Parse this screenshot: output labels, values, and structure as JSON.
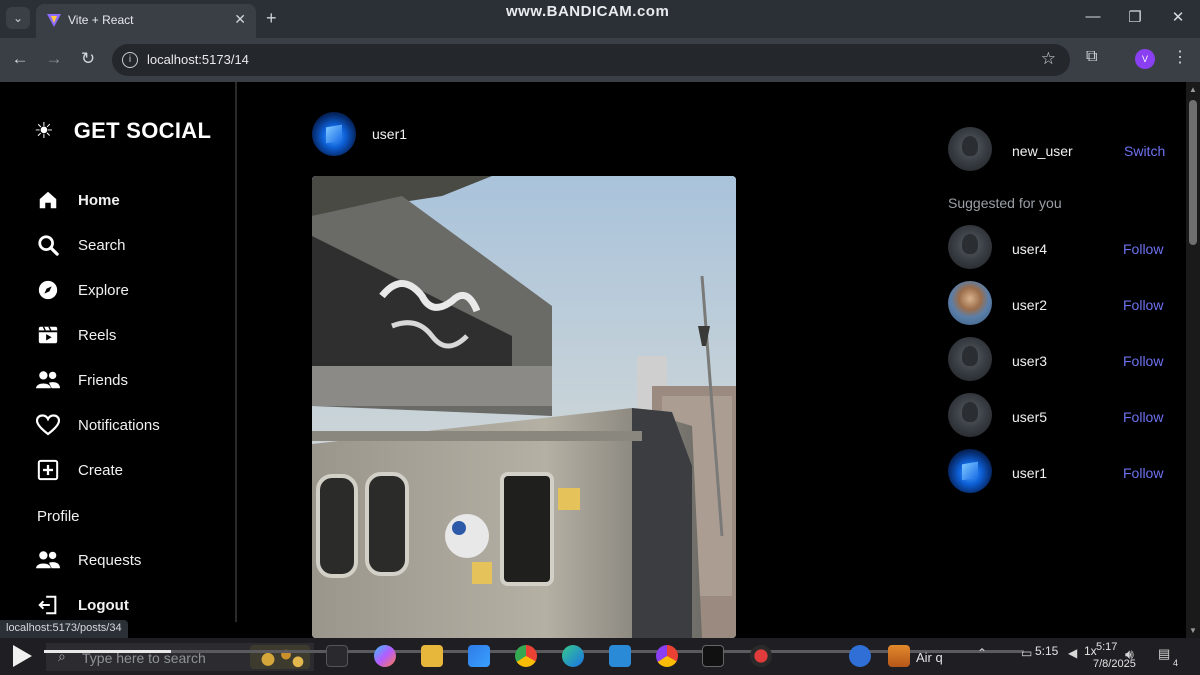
{
  "browser": {
    "tab_title": "Vite + React",
    "url": "localhost:5173/14",
    "status_url": "localhost:5173/posts/34",
    "watermark": "www.BANDICAM.com",
    "profile_initial": "V"
  },
  "app": {
    "brand": "GET SOCIAL",
    "nav": [
      {
        "label": "Home",
        "icon": "home-icon",
        "active": true
      },
      {
        "label": "Search",
        "icon": "search-icon"
      },
      {
        "label": "Explore",
        "icon": "compass-icon"
      },
      {
        "label": "Reels",
        "icon": "film-icon"
      },
      {
        "label": "Friends",
        "icon": "users-icon"
      },
      {
        "label": "Notifications",
        "icon": "heart-icon"
      },
      {
        "label": "Create",
        "icon": "plus-square-icon"
      }
    ],
    "profile_heading": "Profile",
    "nav_bottom": [
      {
        "label": "Requests",
        "icon": "users-icon"
      },
      {
        "label": "Logout",
        "icon": "logout-icon",
        "active": true
      }
    ]
  },
  "post": {
    "username": "user1"
  },
  "current_user": {
    "username": "new_user",
    "action": "Switch"
  },
  "suggestions": {
    "heading": "Suggested for you",
    "users": [
      {
        "username": "user4",
        "action": "Follow",
        "avatar": "gray"
      },
      {
        "username": "user2",
        "action": "Follow",
        "avatar": "photo"
      },
      {
        "username": "user3",
        "action": "Follow",
        "avatar": "gray"
      },
      {
        "username": "user5",
        "action": "Follow",
        "avatar": "gray"
      },
      {
        "username": "user1",
        "action": "Follow",
        "avatar": "blue"
      }
    ]
  },
  "taskbar": {
    "search_placeholder": "Type here to search",
    "weather_text": "Air q",
    "time_player": "5:15",
    "speed": "1x",
    "clock_time": "5:17",
    "clock_date": "7/8/2025",
    "playback_progress": 0.13,
    "notification_count": "4"
  },
  "colors": {
    "accent_link": "#6d72f0",
    "page_bg": "#000000",
    "chrome_bg": "#3a3f46"
  }
}
